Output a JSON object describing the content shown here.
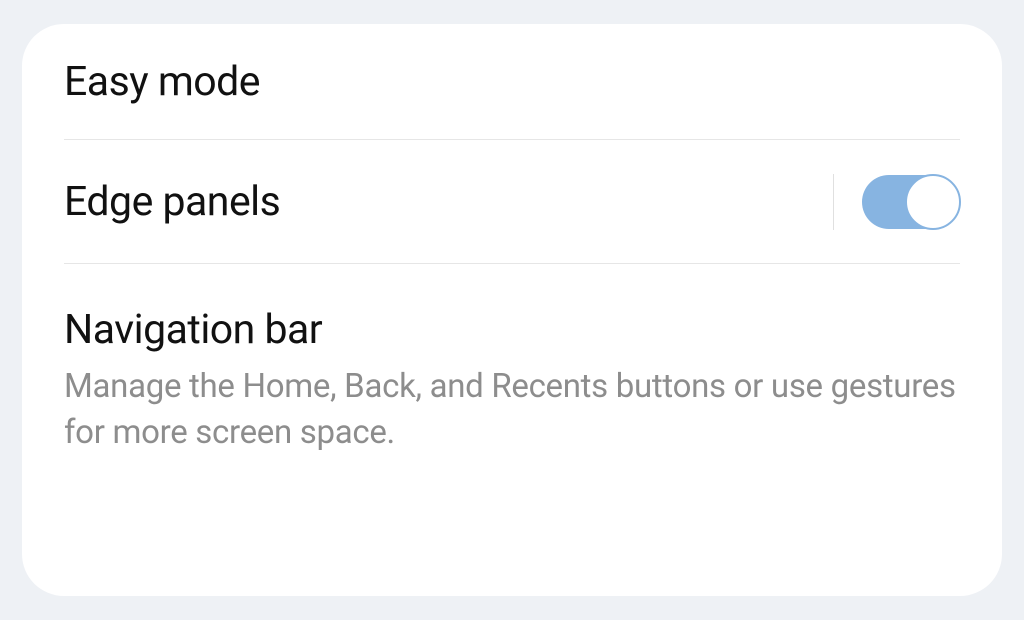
{
  "settings": {
    "easy_mode": {
      "label": "Easy mode"
    },
    "edge_panels": {
      "label": "Edge panels",
      "enabled": true
    },
    "navigation_bar": {
      "label": "Navigation bar",
      "description": "Manage the Home, Back, and Recents buttons or use gestures for more screen space."
    }
  },
  "colors": {
    "toggle_on": "#87b4e1",
    "background": "#eef1f5"
  }
}
